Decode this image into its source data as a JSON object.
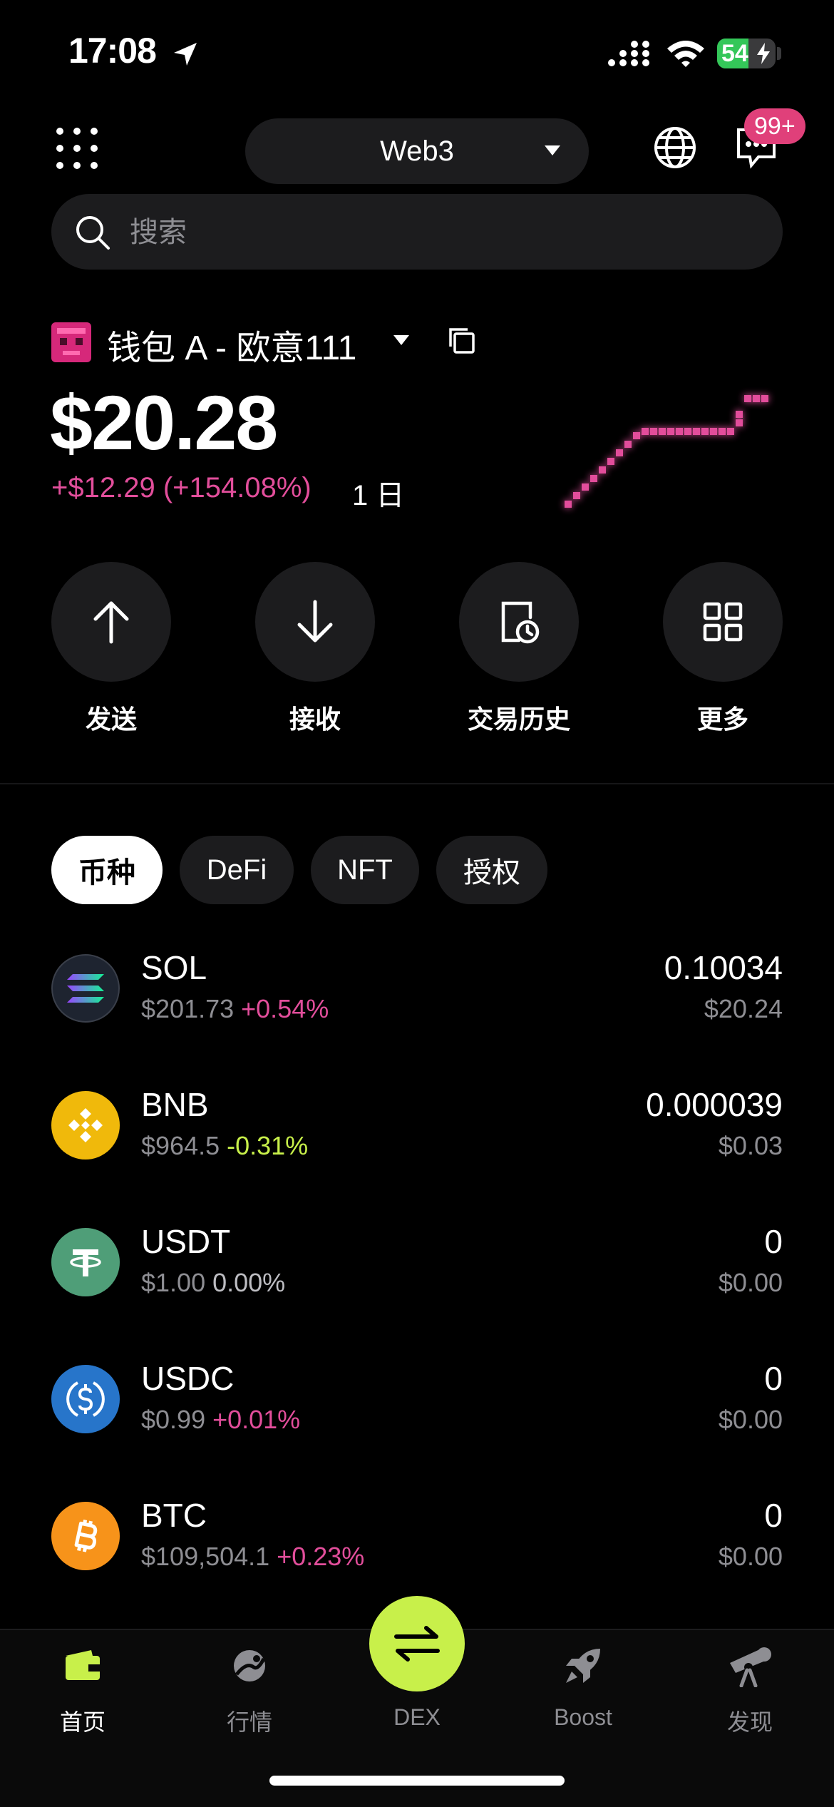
{
  "status_bar": {
    "time": "17:08",
    "battery": "54",
    "battery_level": 0.54
  },
  "header": {
    "account_selector": "Web3",
    "notification_badge": "99+"
  },
  "search": {
    "placeholder": "搜索"
  },
  "wallet": {
    "name": "钱包 A - 欧意111",
    "balance": "$20.28",
    "change": "+$12.29 (+154.08%)",
    "period": "1 日"
  },
  "actions": [
    {
      "label": "发送",
      "icon": "arrow-up-icon"
    },
    {
      "label": "接收",
      "icon": "arrow-down-icon"
    },
    {
      "label": "交易历史",
      "icon": "history-icon"
    },
    {
      "label": "更多",
      "icon": "grid-icon"
    }
  ],
  "tabs": [
    {
      "label": "币种",
      "active": true
    },
    {
      "label": "DeFi",
      "active": false
    },
    {
      "label": "NFT",
      "active": false
    },
    {
      "label": "授权",
      "active": false
    }
  ],
  "tokens": [
    {
      "symbol": "SOL",
      "price": "$201.73",
      "change": "+0.54%",
      "amount": "0.10034",
      "value": "$20.24"
    },
    {
      "symbol": "BNB",
      "price": "$964.5",
      "change": "-0.31%",
      "amount": "0.000039",
      "value": "$0.03"
    },
    {
      "symbol": "USDT",
      "price": "$1.00",
      "change": "0.00%",
      "amount": "0",
      "value": "$0.00"
    },
    {
      "symbol": "USDC",
      "price": "$0.99",
      "change": "+0.01%",
      "amount": "0",
      "value": "$0.00"
    },
    {
      "symbol": "BTC",
      "price": "$109,504.1",
      "change": "+0.23%",
      "amount": "0",
      "value": "$0.00"
    }
  ],
  "bottom_nav": [
    {
      "label": "首页",
      "icon": "wallet-icon",
      "active": true
    },
    {
      "label": "行情",
      "icon": "market-icon",
      "active": false
    },
    {
      "label": "DEX",
      "icon": "swap-icon",
      "active": false
    },
    {
      "label": "Boost",
      "icon": "rocket-icon",
      "active": false
    },
    {
      "label": "发现",
      "icon": "telescope-icon",
      "active": false
    }
  ],
  "colors": {
    "accent_pink": "#e24e9b",
    "accent_lime": "#c8f04a",
    "surface": "#1c1c1e",
    "muted_text": "#8e8e93"
  }
}
